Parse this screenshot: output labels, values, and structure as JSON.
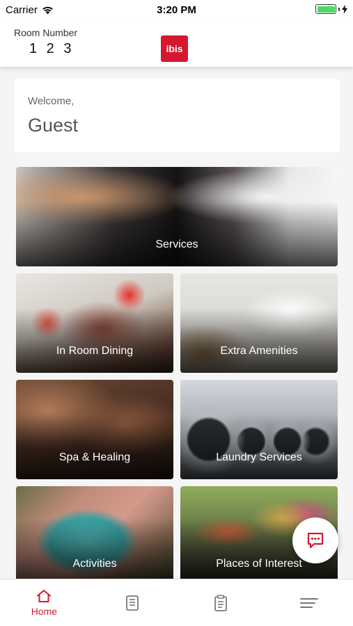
{
  "status_bar": {
    "carrier": "Carrier",
    "time": "3:20 PM",
    "icons": [
      "wifi-icon",
      "battery-icon",
      "charging-bolt-icon"
    ]
  },
  "header": {
    "room_label": "Room Number",
    "room_number": "1 2 3",
    "logo_text": "ibis",
    "brand_color": "#d5182f"
  },
  "welcome": {
    "greeting": "Welcome,",
    "name": "Guest"
  },
  "tiles": [
    {
      "label": "Services",
      "image": "waiter-taking-order-photo"
    },
    {
      "label": "In Room Dining",
      "image": "plated-food-photo"
    },
    {
      "label": "Extra Amenities",
      "image": "bathroom-toiletries-photo"
    },
    {
      "label": "Spa & Healing",
      "image": "massage-photo"
    },
    {
      "label": "Laundry Services",
      "image": "washing-machines-photo"
    },
    {
      "label": "Activities",
      "image": "pool-aerial-photo"
    },
    {
      "label": "Places of Interest",
      "image": "cultural-dancers-photo"
    }
  ],
  "fab": {
    "icon": "chat-icon",
    "color": "#d5182f"
  },
  "tabbar": {
    "tabs": [
      {
        "label": "Home",
        "icon": "home-icon",
        "active": true
      },
      {
        "label": "",
        "icon": "notebook-icon",
        "active": false
      },
      {
        "label": "",
        "icon": "clipboard-icon",
        "active": false
      },
      {
        "label": "",
        "icon": "menu-icon",
        "active": false
      }
    ],
    "active_color": "#d5182f",
    "inactive_color": "#777777"
  }
}
